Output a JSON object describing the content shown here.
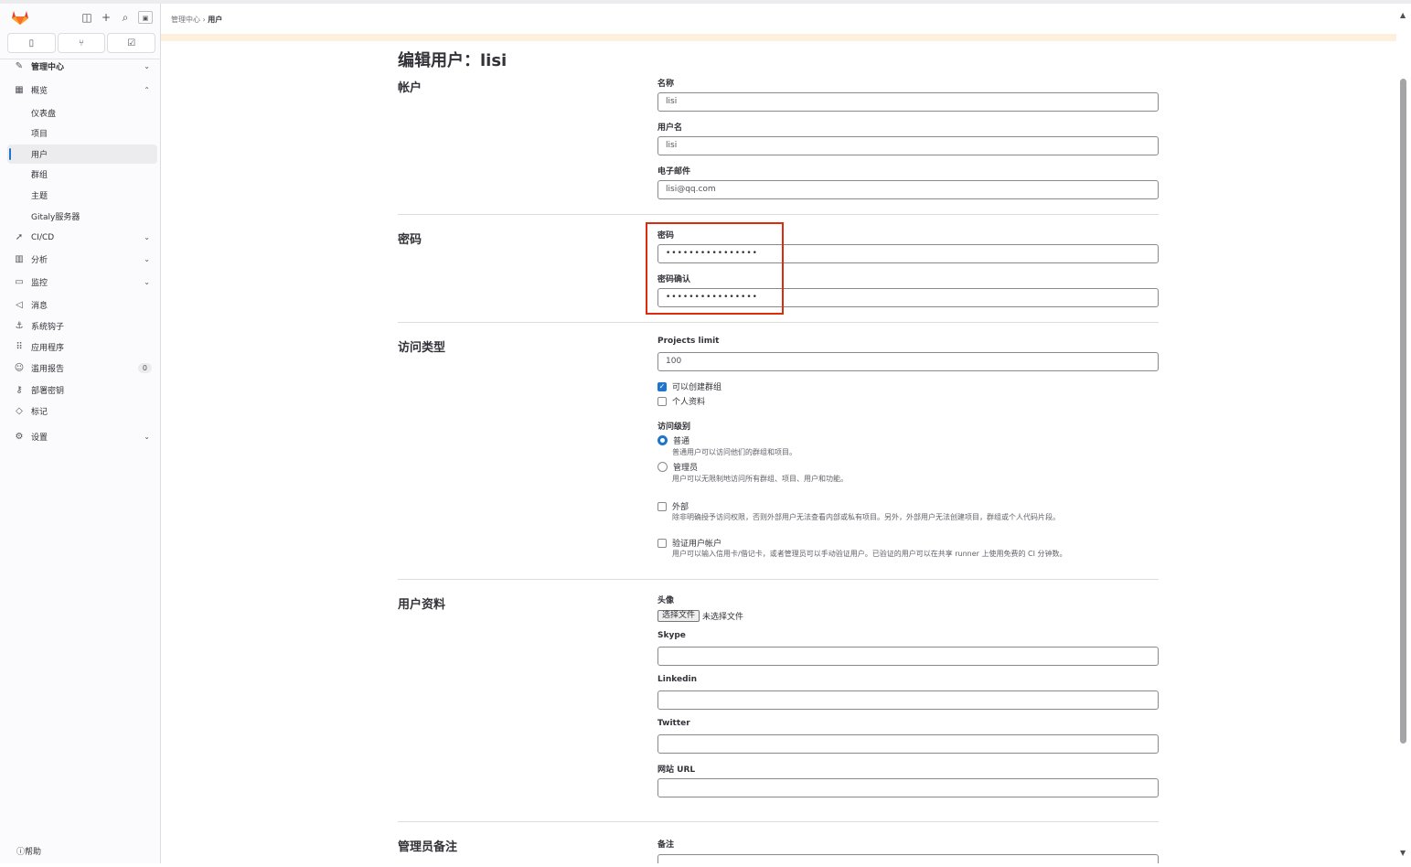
{
  "sidebar": {
    "top_icons": [
      "sidebar-toggle-icon",
      "plus-icon",
      "search-icon",
      "avatar"
    ],
    "tabs": [
      "issues-icon",
      "merge-request-icon",
      "todo-icon"
    ],
    "section": "管理中心",
    "items": [
      {
        "label": "概览",
        "icon": "overview-icon",
        "expanded": true
      },
      {
        "label": "仪表盘"
      },
      {
        "label": "项目"
      },
      {
        "label": "用户",
        "active": true
      },
      {
        "label": "群组"
      },
      {
        "label": "主题"
      },
      {
        "label": "Gitaly服务器"
      },
      {
        "label": "CI/CD",
        "icon": "rocket-icon"
      },
      {
        "label": "分析",
        "icon": "chart-icon"
      },
      {
        "label": "监控",
        "icon": "monitor-icon"
      },
      {
        "label": "消息",
        "icon": "megaphone-icon"
      },
      {
        "label": "系统钩子",
        "icon": "anchor-icon"
      },
      {
        "label": "应用程序",
        "icon": "apps-icon"
      },
      {
        "label": "滥用报告",
        "icon": "abuse-icon",
        "badge": "0"
      },
      {
        "label": "部署密钥",
        "icon": "key-icon"
      },
      {
        "label": "标记",
        "icon": "label-icon"
      },
      {
        "label": "设置",
        "icon": "gear-icon"
      }
    ],
    "help": "帮助"
  },
  "breadcrumb": {
    "parent": "管理中心",
    "current": "用户"
  },
  "page_title": "编辑用户：lisi",
  "account": {
    "title": "帐户",
    "name_label": "名称",
    "name_value": "lisi",
    "username_label": "用户名",
    "username_value": "lisi",
    "email_label": "电子邮件",
    "email_value": "lisi@qq.com"
  },
  "password": {
    "title": "密码",
    "password_label": "密码",
    "password_value": "••••••••••••••••",
    "confirm_label": "密码确认",
    "confirm_value": "••••••••••••••••"
  },
  "access": {
    "title": "访问类型",
    "projects_limit_label": "Projects limit",
    "projects_limit_value": "100",
    "can_create_group": "可以创建群组",
    "private_profile": "个人资料",
    "level_label": "访问级别",
    "regular_label": "普通",
    "regular_help": "普通用户可以访问他们的群组和项目。",
    "admin_label": "管理员",
    "admin_help": "用户可以无限制地访问所有群组、项目、用户和功能。",
    "external_label": "外部",
    "external_help": "除非明确授予访问权限，否则外部用户无法查看内部或私有项目。另外，外部用户无法创建项目，群组或个人代码片段。",
    "verify_label": "验证用户帐户",
    "verify_help": "用户可以输入信用卡/借记卡，或者管理员可以手动验证用户。已验证的用户可以在共享 runner 上使用免费的 CI 分钟数。"
  },
  "profile": {
    "title": "用户资料",
    "avatar_label": "头像",
    "file_button": "选择文件",
    "file_status": "未选择文件",
    "skype_label": "Skype",
    "linkedin_label": "Linkedin",
    "twitter_label": "Twitter",
    "website_label": "网站 URL"
  },
  "admin_notes": {
    "title": "管理员备注",
    "note_label": "备注"
  }
}
